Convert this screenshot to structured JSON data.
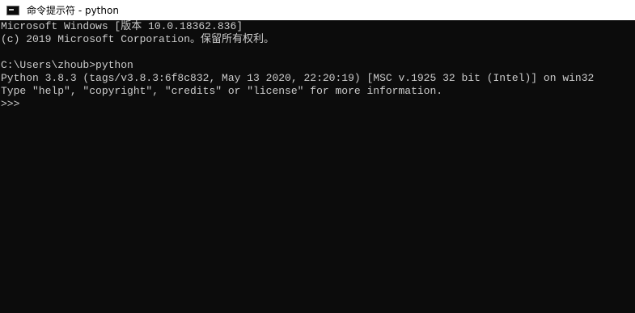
{
  "window": {
    "title": "命令提示符 - python",
    "icon": "cmd-icon"
  },
  "console": {
    "lines": [
      "Microsoft Windows [版本 10.0.18362.836]",
      "(c) 2019 Microsoft Corporation。保留所有权利。",
      "",
      "C:\\Users\\zhoub>python",
      "Python 3.8.3 (tags/v3.8.3:6f8c832, May 13 2020, 22:20:19) [MSC v.1925 32 bit (Intel)] on win32",
      "Type \"help\", \"copyright\", \"credits\" or \"license\" for more information."
    ],
    "prompt": ">>>"
  },
  "colors": {
    "background": "#0c0c0c",
    "text": "#cccccc",
    "titlebar": "#ffffff"
  }
}
